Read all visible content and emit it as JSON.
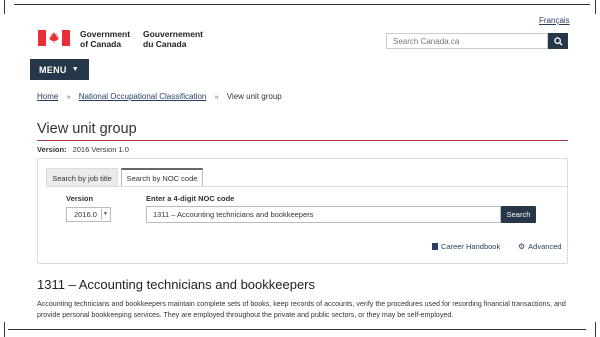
{
  "header": {
    "language_link": "Français",
    "signature_en": [
      "Government",
      "of Canada"
    ],
    "signature_fr": [
      "Gouvernement",
      "du Canada"
    ],
    "search_placeholder": "Search Canada.ca",
    "search_icon": "search-icon",
    "menu_label": "MENU"
  },
  "breadcrumb": {
    "items": [
      "Home",
      "National Occupational Classification",
      "View unit group"
    ]
  },
  "page": {
    "title": "View unit group",
    "version_label": "Version:",
    "version_value": "2016 Version 1.0"
  },
  "search_panel": {
    "tabs": [
      "Search by job title",
      "Search by NOC code"
    ],
    "active_tab": "Search by NOC code",
    "version_field_label": "Version",
    "version_selected": "2016.0",
    "noc_field_label": "Enter a 4-digit NOC code",
    "noc_value": "1311 – Accounting technicians and bookkeepers",
    "search_button": "Search",
    "links": [
      "Career Handbook",
      "Advanced"
    ]
  },
  "unit_group": {
    "heading": "1311 – Accounting technicians and bookkeepers",
    "description": "Accounting technicians and bookkeepers maintain complete sets of books, keep records of accounts, verify the procedures used for recording financial transactions, and provide personal bookkeeping services. They are employed throughout the private and public sectors, or they may be self-employed."
  },
  "colors": {
    "primary_dark": "#26374a",
    "link": "#284162",
    "title_rule": "#af3c43",
    "flag_red": "#eb2d37"
  }
}
